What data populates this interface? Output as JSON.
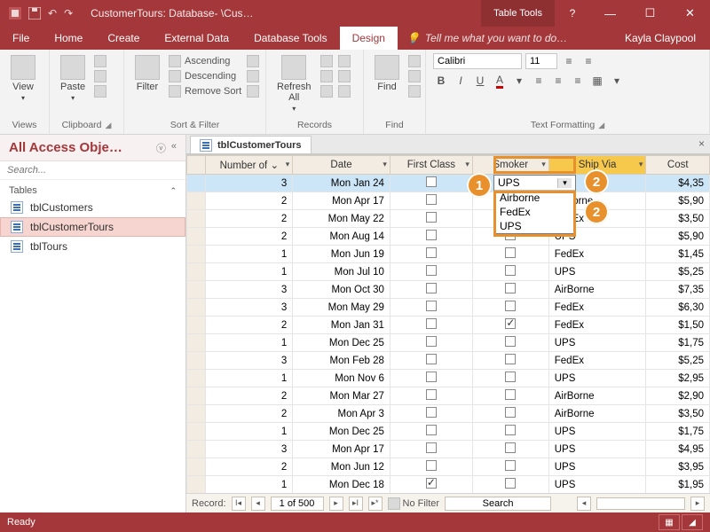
{
  "titlebar": {
    "title": "CustomerTours: Database- \\Cus…",
    "table_tools": "Table Tools",
    "help": "?"
  },
  "menutabs": {
    "file": "File",
    "home": "Home",
    "create": "Create",
    "external_data": "External Data",
    "database_tools": "Database Tools",
    "design": "Design",
    "tellme_icon": "💡",
    "tellme": "Tell me what you want to do…",
    "user": "Kayla Claypool"
  },
  "ribbon": {
    "views": {
      "label": "Views",
      "view": "View"
    },
    "clipboard": {
      "label": "Clipboard",
      "paste": "Paste"
    },
    "sortfilter": {
      "label": "Sort & Filter",
      "filter": "Filter",
      "asc": "Ascending",
      "desc": "Descending",
      "remove": "Remove Sort"
    },
    "records": {
      "label": "Records",
      "refresh": "Refresh\nAll"
    },
    "find": {
      "label": "Find",
      "find": "Find"
    },
    "textfmt": {
      "label": "Text Formatting",
      "font": "Calibri",
      "size": "11",
      "bold": "B",
      "italic": "I",
      "underline": "U"
    }
  },
  "nav": {
    "title": "All Access Obje…",
    "search_placeholder": "Search...",
    "group": "Tables",
    "items": [
      {
        "label": "tblCustomers"
      },
      {
        "label": "tblCustomerTours"
      },
      {
        "label": "tblTours"
      }
    ],
    "selected_index": 1
  },
  "doc": {
    "tab": "tblCustomerTours",
    "close": "×",
    "columns": {
      "num": "Number of ⌄",
      "date": "Date",
      "first": "First Class",
      "smoker": "Smoker",
      "shipvia": "Ship Via",
      "cost": "Cost"
    },
    "rows": [
      {
        "num": "3",
        "date": "Mon Jan 24",
        "first": false,
        "smoker": false,
        "ship": "UPS",
        "cost": "$4,35"
      },
      {
        "num": "2",
        "date": "Mon Apr 17",
        "first": false,
        "smoker": false,
        "ship": "Airborne",
        "cost": "$5,90"
      },
      {
        "num": "2",
        "date": "Mon May 22",
        "first": false,
        "smoker": true,
        "ship": "FedEx",
        "cost": "$3,50"
      },
      {
        "num": "2",
        "date": "Mon Aug 14",
        "first": false,
        "smoker": false,
        "ship": "UPS",
        "cost": "$5,90"
      },
      {
        "num": "1",
        "date": "Mon Jun 19",
        "first": false,
        "smoker": false,
        "ship": "FedEx",
        "cost": "$1,45"
      },
      {
        "num": "1",
        "date": "Mon Jul 10",
        "first": false,
        "smoker": false,
        "ship": "UPS",
        "cost": "$5,25"
      },
      {
        "num": "3",
        "date": "Mon Oct 30",
        "first": false,
        "smoker": false,
        "ship": "AirBorne",
        "cost": "$7,35"
      },
      {
        "num": "3",
        "date": "Mon May 29",
        "first": false,
        "smoker": false,
        "ship": "FedEx",
        "cost": "$6,30"
      },
      {
        "num": "2",
        "date": "Mon Jan 31",
        "first": false,
        "smoker": true,
        "ship": "FedEx",
        "cost": "$1,50"
      },
      {
        "num": "1",
        "date": "Mon Dec 25",
        "first": false,
        "smoker": false,
        "ship": "UPS",
        "cost": "$1,75"
      },
      {
        "num": "3",
        "date": "Mon Feb 28",
        "first": false,
        "smoker": false,
        "ship": "FedEx",
        "cost": "$5,25"
      },
      {
        "num": "1",
        "date": "Mon Nov 6",
        "first": false,
        "smoker": false,
        "ship": "UPS",
        "cost": "$2,95"
      },
      {
        "num": "2",
        "date": "Mon Mar 27",
        "first": false,
        "smoker": false,
        "ship": "AirBorne",
        "cost": "$2,90"
      },
      {
        "num": "2",
        "date": "Mon Apr 3",
        "first": false,
        "smoker": false,
        "ship": "AirBorne",
        "cost": "$3,50"
      },
      {
        "num": "1",
        "date": "Mon Dec 25",
        "first": false,
        "smoker": false,
        "ship": "UPS",
        "cost": "$1,75"
      },
      {
        "num": "3",
        "date": "Mon Apr 17",
        "first": false,
        "smoker": false,
        "ship": "UPS",
        "cost": "$4,95"
      },
      {
        "num": "2",
        "date": "Mon Jun 12",
        "first": false,
        "smoker": false,
        "ship": "UPS",
        "cost": "$3,95"
      },
      {
        "num": "1",
        "date": "Mon Dec 18",
        "first": true,
        "smoker": false,
        "ship": "UPS",
        "cost": "$1,95"
      }
    ],
    "dropdown": {
      "selected": "UPS",
      "options": [
        "Airborne",
        "FedEx",
        "UPS"
      ]
    },
    "recnav": {
      "label": "Record:",
      "pos": "1 of 500",
      "nofilter": "No Filter",
      "search": "Search"
    }
  },
  "status": {
    "ready": "Ready"
  },
  "callouts": {
    "one": "1",
    "two": "2"
  }
}
